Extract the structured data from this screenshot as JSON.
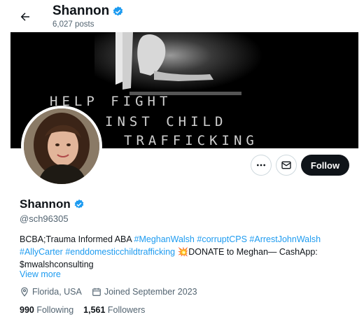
{
  "header": {
    "name": "Shannon",
    "posts": "6,027 posts"
  },
  "banner": {
    "line1": "HELP FIGHT",
    "line2": "INST CHILD",
    "line3": "TRAFFICKING"
  },
  "actions": {
    "follow_label": "Follow"
  },
  "profile": {
    "name": "Shannon",
    "handle": "@sch96305",
    "bio": {
      "p1": "BCBA;Trauma Informed ABA ",
      "t1": "#MeghanWalsh",
      "t2": "#corruptCPS",
      "t3": "#ArrestJohnWalsh",
      "t4": "#AllyCarter",
      "t5": "#enddomesticchildtrafficking",
      "emoji": "💥",
      "p2": "DONATE to Meghan— CashApp: $mwalshconsulting"
    },
    "view_more": "View more",
    "location": "Florida, USA",
    "joined": "Joined September 2023",
    "following_count": "990",
    "following_label": "Following",
    "followers_count": "1,561",
    "followers_label": "Followers"
  },
  "colors": {
    "accent": "#1d9bf0",
    "text": "#0f1419",
    "muted": "#536471",
    "follow_bg": "#0f1419"
  },
  "icons": [
    "back-arrow-icon",
    "verified-badge-icon",
    "more-icon",
    "message-icon",
    "location-icon",
    "calendar-icon"
  ]
}
